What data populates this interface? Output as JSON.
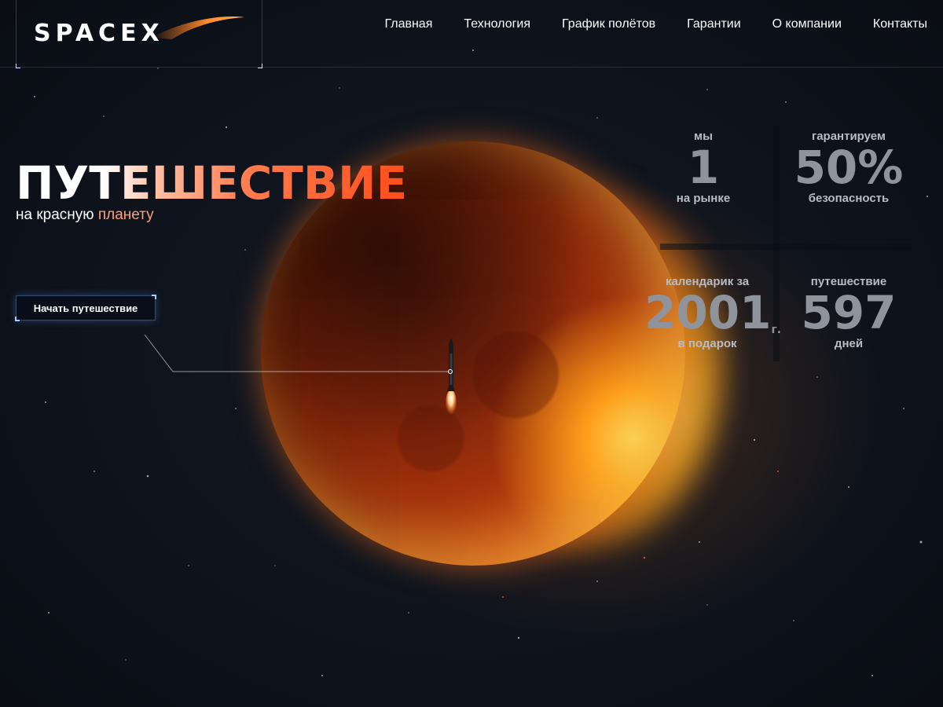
{
  "brand": {
    "logo_text": "SPACEX"
  },
  "nav": {
    "items": [
      {
        "label": "Главная"
      },
      {
        "label": "Технология"
      },
      {
        "label": "График полётов"
      },
      {
        "label": "Гарантии"
      },
      {
        "label": "О компании"
      },
      {
        "label": "Контакты"
      }
    ]
  },
  "hero": {
    "title": "ПУТЕШЕСТВИЕ",
    "subtitle_part1": "на красную ",
    "subtitle_part2": "планету",
    "cta_label": "Начать путешествие"
  },
  "stats": [
    {
      "label": "мы",
      "value": "1",
      "suffix": "",
      "caption": "на рынке"
    },
    {
      "label": "гарантируем",
      "value": "50%",
      "suffix": "",
      "caption": "безопасность"
    },
    {
      "label": "календарик за",
      "value": "2001",
      "suffix": "г.",
      "caption": "в подарок"
    },
    {
      "label": "путешествие",
      "value": "597",
      "suffix": "",
      "caption": "дней"
    }
  ],
  "colors": {
    "accent_orange": "#ff4d1a",
    "stat_gray": "#8f949c",
    "background": "#0b0f17"
  }
}
